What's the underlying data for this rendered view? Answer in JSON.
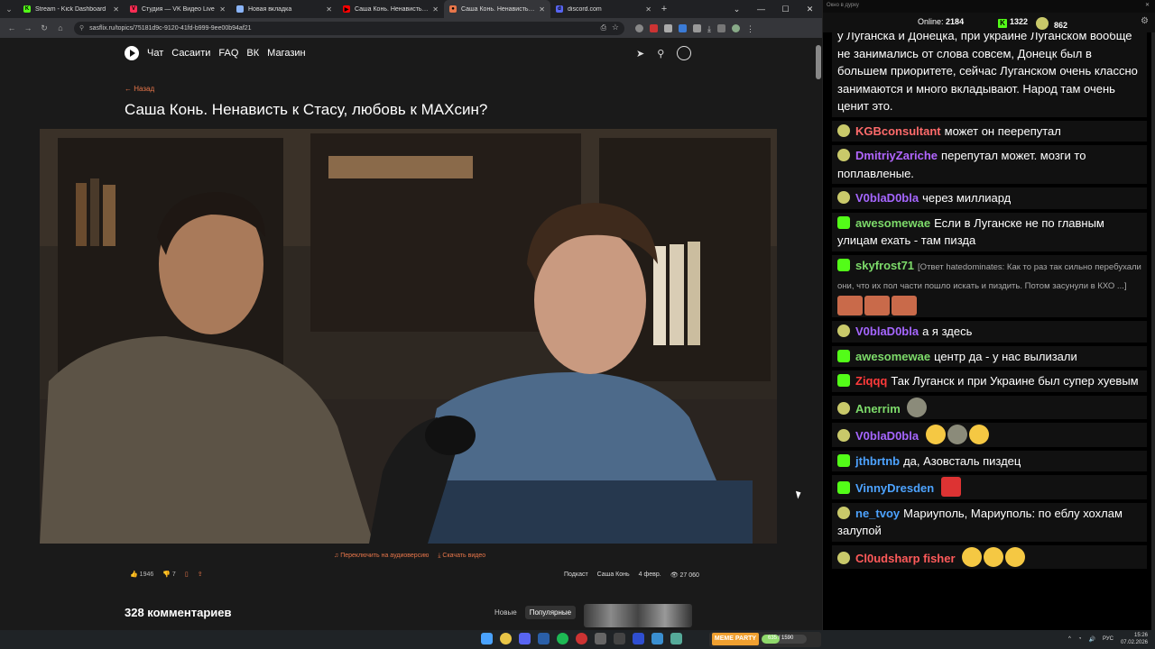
{
  "browser": {
    "tabs": [
      {
        "title": "Stream - Kick Dashboard",
        "fav_color": "#53fc18",
        "fav_letter": "K"
      },
      {
        "title": "Студия — VK Видео Live",
        "fav_color": "#ff2d55",
        "fav_letter": "V"
      },
      {
        "title": "Новая вкладка",
        "fav_color": "#8ab4f8",
        "fav_letter": ""
      },
      {
        "title": "Саша Конь. Ненависть к Стас",
        "fav_color": "#ff0000",
        "fav_letter": "▶"
      },
      {
        "title": "Саша Конь. Ненависть к С",
        "fav_color": "#e8764a",
        "fav_letter": "●"
      },
      {
        "title": "discord.com",
        "fav_color": "#5865f2",
        "fav_letter": "d"
      }
    ],
    "url": "sasflix.ru/topics/75181d9c-9120-41fd-b999-9ee00b94af21"
  },
  "site": {
    "nav": [
      "Чат",
      "Сасаити",
      "FAQ",
      "ВК",
      "Магазин"
    ],
    "back_label": "← Назад",
    "title": "Саша Конь. Ненависть к Стасу, любовь к МАХсин?",
    "audio_link": "Переключить на аудиоверсию",
    "download_link": "Скачать видео",
    "likes": "1946",
    "dislikes": "7",
    "tag1": "Подкаст",
    "tag2": "Саша Конь",
    "date": "4 февр.",
    "views": "27 060",
    "comments_title": "328 комментариев",
    "sort_new": "Новые",
    "sort_popular": "Популярные"
  },
  "chat": {
    "window_title": "Окно в дурку",
    "online_label": "Online:",
    "online_count": "2184",
    "kick_count": "1322",
    "pepe_count": "862",
    "top_text": "у Луганска и Донецка, при украине Луганском вообще не занимались от слова совсем, Донецк был в большем приоритете, сейчас Луганском очень классно занимаются и много вкладывают. Народ там очень ценит это.",
    "messages": [
      {
        "name": "KGBconsultant",
        "color": "#ff6b6b",
        "badge": "p",
        "text": "может он пеерепутал"
      },
      {
        "name": "DmitriyZariche",
        "color": "#b266ff",
        "badge": "p",
        "text": "перепутал может. мозги то поплавленые."
      },
      {
        "name": "V0blaD0bla",
        "color": "#a566ff",
        "badge": "p",
        "text": "через миллиард"
      },
      {
        "name": "awesomewae",
        "color": "#7ddb6a",
        "badge": "k",
        "text": "Если в Луганске не по главным улицам ехать - там пизда"
      },
      {
        "name": "skyfrost71",
        "color": "#7ddb6a",
        "badge": "k",
        "reply": "[Ответ hatedominates: Как то раз так сильно перебухали они, что их пол части пошло искать и пиздить. Потом засунули в КХО ...]",
        "text": ""
      },
      {
        "name": "V0blaD0bla",
        "color": "#a566ff",
        "badge": "p",
        "text": "а я здесь"
      },
      {
        "name": "awesomewae",
        "color": "#7ddb6a",
        "badge": "k",
        "text": "центр да - у нас вылизали"
      },
      {
        "name": "Ziqqq",
        "color": "#ff3b3b",
        "badge": "k",
        "text": "Так Луганск и при Украине был супер хуевым"
      },
      {
        "name": "Anerrim",
        "color": "#7ddb6a",
        "badge": "p",
        "text": ""
      },
      {
        "name": "V0blaD0bla",
        "color": "#a566ff",
        "badge": "p",
        "text": ""
      },
      {
        "name": "jthbrtnb",
        "color": "#4da3ff",
        "badge": "k",
        "text": "да, Азовсталь пиздец"
      },
      {
        "name": "VinnyDresden",
        "color": "#4da3ff",
        "badge": "k",
        "text": ""
      },
      {
        "name": "ne_tvoy",
        "color": "#4da3ff",
        "badge": "p",
        "text": "Мариуполь, Мариуполь: по еблу хохлам залупой"
      },
      {
        "name": "Cl0udsharp fisher",
        "color": "#ff5a5a",
        "badge": "p",
        "text": ""
      }
    ]
  },
  "taskbar": {
    "meme_label": "MEME PARTY",
    "meme_count": "635 / 1590",
    "meme_progress": 0.4,
    "lang": "РУС",
    "time": "15:26",
    "date": "07.02.2026"
  }
}
